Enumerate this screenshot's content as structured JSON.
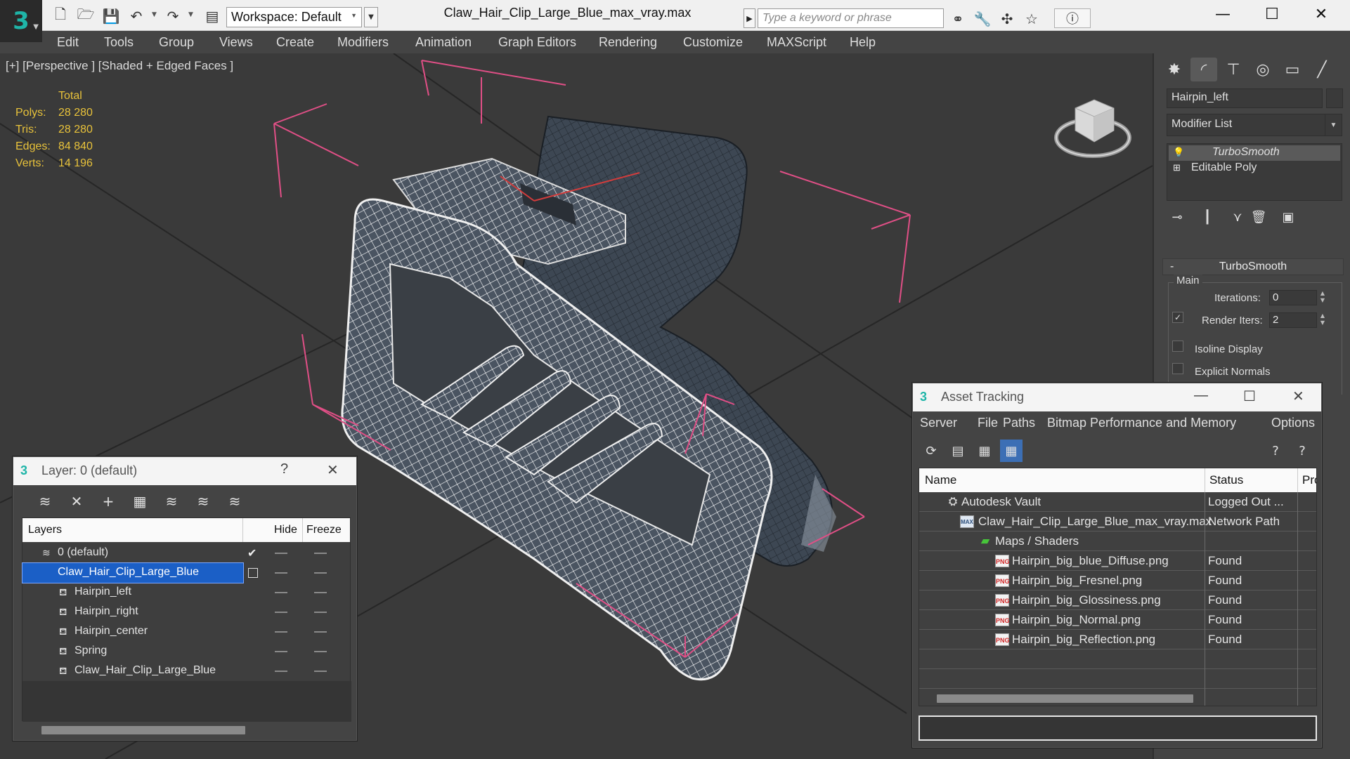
{
  "app": {
    "title": "Claw_Hair_Clip_Large_Blue_max_vray.max",
    "workspace": "Workspace: Default",
    "search_placeholder": "Type a keyword or phrase"
  },
  "menu": [
    "Edit",
    "Tools",
    "Group",
    "Views",
    "Create",
    "Modifiers",
    "Animation",
    "Graph Editors",
    "Rendering",
    "Customize",
    "MAXScript",
    "Help"
  ],
  "viewport": {
    "label": "[+] [Perspective ] [Shaded + Edged Faces ]",
    "stats": {
      "header": "Total",
      "rows": [
        {
          "k": "Polys:",
          "v": "28 280"
        },
        {
          "k": "Tris:",
          "v": "28 280"
        },
        {
          "k": "Edges:",
          "v": "84 840"
        },
        {
          "k": "Verts:",
          "v": "14 196"
        }
      ]
    }
  },
  "command_panel": {
    "object_name": "Hairpin_left",
    "modifier_list": "Modifier List",
    "stack": [
      {
        "label": "TurboSmooth",
        "selected": true
      },
      {
        "label": "Editable Poly",
        "selected": false
      }
    ],
    "rollout": {
      "title": "TurboSmooth",
      "group": "Main",
      "iterations_label": "Iterations:",
      "iterations": "0",
      "render_iters_label": "Render Iters:",
      "render_iters": "2",
      "render_iters_checked": true,
      "isoline_label": "Isoline Display",
      "isoline_checked": false,
      "explicit_label": "Explicit Normals",
      "explicit_checked": false
    }
  },
  "layer_dialog": {
    "title": "Layer: 0 (default)",
    "help": "?",
    "columns": {
      "layers": "Layers",
      "hide": "Hide",
      "freeze": "Freeze"
    },
    "rows": [
      {
        "name": "0 (default)",
        "level": 0,
        "type": "layer",
        "current": true
      },
      {
        "name": "Claw_Hair_Clip_Large_Blue",
        "level": 0,
        "type": "layer",
        "selected": true
      },
      {
        "name": "Hairpin_left",
        "level": 1,
        "type": "object"
      },
      {
        "name": "Hairpin_right",
        "level": 1,
        "type": "object"
      },
      {
        "name": "Hairpin_center",
        "level": 1,
        "type": "object"
      },
      {
        "name": "Spring",
        "level": 1,
        "type": "object"
      },
      {
        "name": "Claw_Hair_Clip_Large_Blue",
        "level": 1,
        "type": "object"
      }
    ]
  },
  "asset_dialog": {
    "title": "Asset Tracking",
    "menu": [
      "Server",
      "File",
      "Paths",
      "Bitmap Performance and Memory",
      "Options"
    ],
    "columns": {
      "name": "Name",
      "status": "Status",
      "extra": "Pro"
    },
    "rows": [
      {
        "name": "Autodesk Vault",
        "status": "Logged Out ...",
        "icon": "vault"
      },
      {
        "name": "Claw_Hair_Clip_Large_Blue_max_vray.max",
        "status": "Network Path",
        "icon": "max",
        "icon_text": "MAX"
      },
      {
        "name": "Maps / Shaders",
        "status": "",
        "icon": "maps"
      },
      {
        "name": "Hairpin_big_blue_Diffuse.png",
        "status": "Found",
        "icon": "png",
        "icon_text": "PNG"
      },
      {
        "name": "Hairpin_big_Fresnel.png",
        "status": "Found",
        "icon": "png",
        "icon_text": "PNG"
      },
      {
        "name": "Hairpin_big_Glossiness.png",
        "status": "Found",
        "icon": "png",
        "icon_text": "PNG"
      },
      {
        "name": "Hairpin_big_Normal.png",
        "status": "Found",
        "icon": "png",
        "icon_text": "PNG"
      },
      {
        "name": "Hairpin_big_Reflection.png",
        "status": "Found",
        "icon": "png",
        "icon_text": "PNG"
      }
    ]
  },
  "colors": {
    "accent_teal": "#1fb5a8",
    "selection_blue": "#1b5fc6",
    "stats_yellow": "#e8c23a",
    "bbox_pink": "#e04f86"
  }
}
